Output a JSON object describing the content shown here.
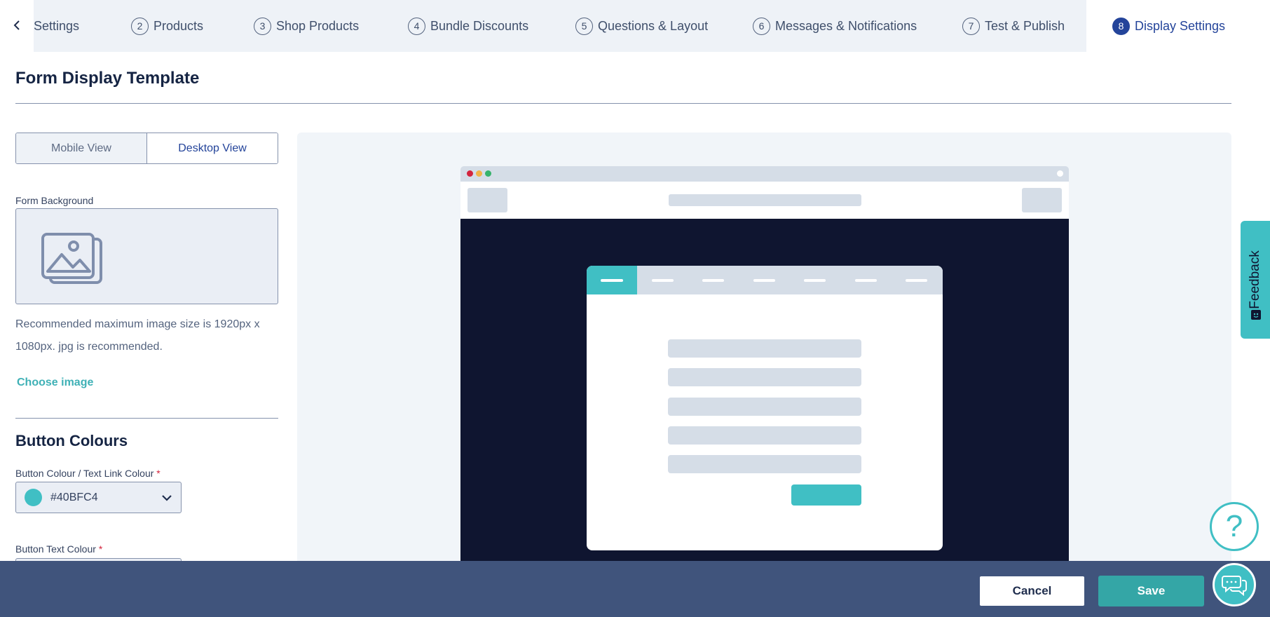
{
  "steps": [
    {
      "label": "Settings"
    },
    {
      "num": "2",
      "label": "Products"
    },
    {
      "num": "3",
      "label": "Shop Products"
    },
    {
      "num": "4",
      "label": "Bundle Discounts"
    },
    {
      "num": "5",
      "label": "Questions & Layout"
    },
    {
      "num": "6",
      "label": "Messages & Notifications"
    },
    {
      "num": "7",
      "label": "Test & Publish"
    },
    {
      "num": "8",
      "label": "Display Settings",
      "active": true
    }
  ],
  "page_title": "Form Display Template",
  "view_toggle": {
    "mobile": "Mobile View",
    "desktop": "Desktop View",
    "selected": "desktop"
  },
  "form_background": {
    "label": "Form Background",
    "hint": "Recommended maximum image size is 1920px x 1080px. jpg is recommended.",
    "choose_label": "Choose image"
  },
  "button_colours": {
    "title": "Button Colours",
    "button_colour_label": "Button Colour / Text Link Colour",
    "button_colour_value": "#40BFC4",
    "button_text_colour_label": "Button Text Colour",
    "required_mark": "*"
  },
  "actions": {
    "cancel": "Cancel",
    "save": "Save"
  },
  "feedback_label": "Feedback",
  "help_glyph": "?",
  "colors": {
    "accent": "#40BFC4",
    "primary": "#24449A",
    "action_bar": "#40547C",
    "preview_bg": "#0F1530",
    "save": "#34A6A6"
  },
  "icons": {
    "back": "chevron-left-icon",
    "image_placeholder": "image-icon",
    "dropdown": "chevron-down-icon",
    "help": "question-icon",
    "chat": "chat-icon"
  }
}
